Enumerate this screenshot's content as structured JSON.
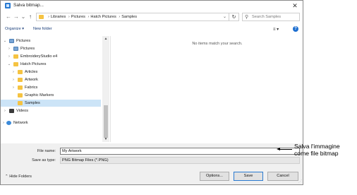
{
  "window": {
    "title": "Salva bitmap..."
  },
  "navigation": {
    "breadcrumb": [
      "Libraries",
      "Pictures",
      "Hatch Pictures",
      "Samples"
    ],
    "search_placeholder": "Search Samples"
  },
  "toolbar": {
    "organize_label": "Organize ▾",
    "new_folder_label": "New folder"
  },
  "tree": [
    {
      "label": "Pictures",
      "expanded": true,
      "icon": "library-icon"
    },
    {
      "label": "Pictures",
      "expanded": false,
      "icon": "library-icon"
    },
    {
      "label": "EmbroideryStudio e4",
      "expanded": false,
      "icon": "folder-icon"
    },
    {
      "label": "Hatch Pictures",
      "expanded": true,
      "icon": "folder-icon"
    },
    {
      "label": "Articles",
      "expanded": false,
      "icon": "folder-icon"
    },
    {
      "label": "Artwork",
      "expanded": false,
      "icon": "folder-icon"
    },
    {
      "label": "Fabrics",
      "expanded": false,
      "icon": "folder-icon"
    },
    {
      "label": "Graphic Markers",
      "icon": "folder-icon"
    },
    {
      "label": "Samples",
      "selected": true,
      "icon": "folder-icon"
    },
    {
      "label": "Videos",
      "expanded": false,
      "icon": "video-icon"
    },
    {
      "label": "Network",
      "expanded": false,
      "icon": "network-icon"
    }
  ],
  "content": {
    "empty_message": "No items match your search."
  },
  "footer": {
    "file_name_label": "File name:",
    "file_name_value": "My Artwork",
    "save_type_label": "Save as type:",
    "save_type_value": "PNG Bitmap Files (*.PNG)",
    "hide_folders_label": "Hide Folders",
    "options_label": "Options...",
    "save_label": "Save",
    "cancel_label": "Cancel"
  },
  "annotation": {
    "text": "Salva l'immagine come file bitmap"
  },
  "colors": {
    "accent": "#2b7bd1",
    "selection": "#cce4f7",
    "folder": "#f5c342"
  }
}
